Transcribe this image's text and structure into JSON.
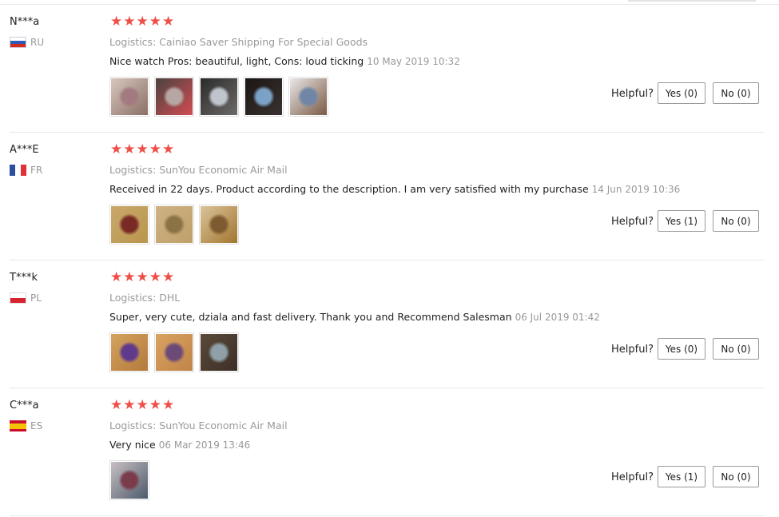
{
  "helpful_label": "Helpful?",
  "star_color": "#ee5048",
  "reviews": [
    {
      "user": "N***a",
      "country": "RU",
      "rating": 5,
      "logistics": "Logistics: Cainiao Saver Shipping For Special Goods",
      "text": "Nice watch Pros: beautiful, light, Cons: loud ticking",
      "date": "10 May 2019 10:32",
      "yes": "Yes (0)",
      "no": "No (0)",
      "photos": [
        {
          "name": "photo-1",
          "colors": [
            "#d8c7bd",
            "#a37a80",
            "#8a6f66"
          ]
        },
        {
          "name": "photo-2",
          "colors": [
            "#4a4340",
            "#b6a7a2",
            "#d24c52"
          ]
        },
        {
          "name": "photo-3",
          "colors": [
            "#2b2b2b",
            "#c0c5cc",
            "#6d6a68"
          ]
        },
        {
          "name": "photo-4",
          "colors": [
            "#1a1614",
            "#7ba1c6",
            "#3a3230"
          ]
        },
        {
          "name": "photo-5",
          "colors": [
            "#e9e7e8",
            "#6f86a6",
            "#7a5a44"
          ]
        }
      ]
    },
    {
      "user": "A***E",
      "country": "FR",
      "rating": 5,
      "logistics": "Logistics: SunYou Economic Air Mail",
      "text": "Received in 22 days. Product according to the description. I am very satisfied with my purchase",
      "date": "14 Jun 2019 10:36",
      "yes": "Yes (1)",
      "no": "No (0)",
      "photos": [
        {
          "name": "photo-1",
          "colors": [
            "#c9a86c",
            "#7a2a25",
            "#b9964d"
          ]
        },
        {
          "name": "photo-2",
          "colors": [
            "#cfb283",
            "#8c7346",
            "#bfa06a"
          ]
        },
        {
          "name": "photo-3",
          "colors": [
            "#d9c39a",
            "#7e5a30",
            "#a3762e"
          ]
        }
      ]
    },
    {
      "user": "T***k",
      "country": "PL",
      "rating": 5,
      "logistics": "Logistics: DHL",
      "text": "Super, very cute, dziala and fast delivery. Thank you and Recommend Salesman",
      "date": "06 Jul 2019 01:42",
      "yes": "Yes (0)",
      "no": "No (0)",
      "photos": [
        {
          "name": "photo-1",
          "colors": [
            "#d6a35f",
            "#5f3a8c",
            "#b27a3c"
          ]
        },
        {
          "name": "photo-2",
          "colors": [
            "#d9a361",
            "#6b4a78",
            "#c08448"
          ]
        },
        {
          "name": "photo-3",
          "colors": [
            "#5a4a3a",
            "#8fa0a8",
            "#3c2f26"
          ]
        }
      ]
    },
    {
      "user": "C***a",
      "country": "ES",
      "rating": 5,
      "logistics": "Logistics: SunYou Economic Air Mail",
      "text": "Very nice",
      "date": "06 Mar 2019 13:46",
      "yes": "Yes (1)",
      "no": "No (0)",
      "photos": [
        {
          "name": "photo-1",
          "colors": [
            "#c8c0c4",
            "#7a3c4a",
            "#4d5a6a"
          ]
        }
      ]
    }
  ]
}
